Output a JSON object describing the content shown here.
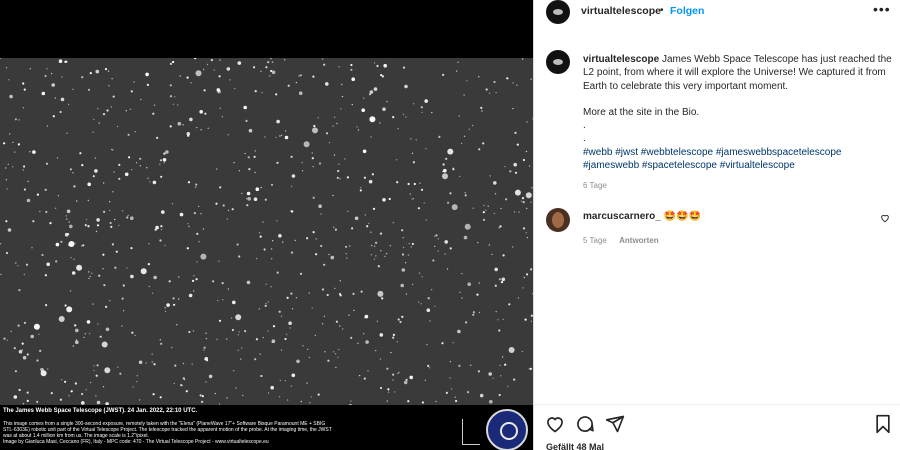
{
  "media": {
    "caption_title": "The James Webb Space Telescope (JWST). 24 Jan. 2022, 22:10 UTC.",
    "caption_lines": [
      "This image comes from a single 300-second exposure, remotely taken with the \"Elena\" (PlaneWave 17\"+ Software Bisque Paramount ME + SBIG",
      "STL-6303E) robotic unit part of the Virtual Telescope Project. The telescope tracked the apparent motion of the probe. At the imaging time, the JWST",
      "was at about 1.4 million km from us.  The image scale is 1.2\"/pixel.",
      "Image by Gianluca Masi, Ceccano (FR), Italy - MPC code: 470 - The Virtual Telescope Project -        www.virtualtelescope.eu"
    ]
  },
  "header": {
    "username": "virtualtelescope",
    "separator": "•",
    "follow_label": "Folgen",
    "more_glyph": "•••"
  },
  "post": {
    "username": "virtualtelescope",
    "text": "James Webb Space Telescope has just reached the L2 point, from where it will explore the Universe! We captured it from Earth to celebrate this very important moment.",
    "more": "More at the site in the Bio.",
    "dot1": ".",
    "dot2": ".",
    "hashtags_line1": "#webb #jwst #webbtelescope #jameswebbspacetelescope",
    "hashtags_line2": "#jameswebb #spacetelescope #virtualtelescope",
    "time": "6 Tage"
  },
  "comment": {
    "username": "marcuscarnero_",
    "text": "🤩🤩🤩",
    "time": "5 Tage",
    "reply_label": "Antworten"
  },
  "footer": {
    "likes": "Gefällt 48 Mal"
  },
  "icons": {
    "like": "heart-outline-icon",
    "comment": "speech-bubble-icon",
    "share": "paper-plane-icon",
    "save": "bookmark-icon"
  }
}
